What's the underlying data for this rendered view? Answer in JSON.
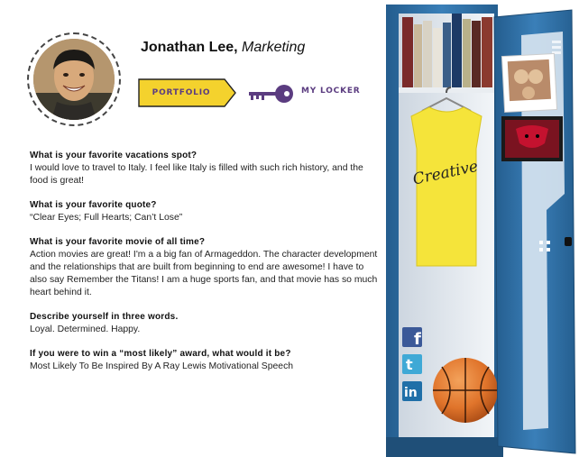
{
  "colors": {
    "locker_blue": "#2f6ea3",
    "portfolio_yellow": "#f4d22d",
    "label_purple": "#5b3c80",
    "shirt_yellow": "#f5e43a",
    "basketball": "#e0742b"
  },
  "profile": {
    "name": "Jonathan Lee,",
    "department": "Marketing",
    "avatar_icon": "profile-photo"
  },
  "nav": {
    "portfolio_label": "PORTFOLIO",
    "key_icon": "key-icon",
    "my_locker_label": "MY LOCKER"
  },
  "qa": [
    {
      "question": "What is your favorite vacations spot?",
      "answer": "I would love to travel to Italy. I feel like Italy is filled with such rich history, and the food is great!"
    },
    {
      "question": "What is your favorite quote?",
      "answer": "“Clear Eyes; Full Hearts; Can’t Lose”"
    },
    {
      "question": "What is your favorite movie of all time?",
      "answer": "Action movies are great! I'm a a big fan of Armageddon. The character development and the relationships that are built from beginning to end are awesome! I have to also say Remember the Titans! I am a huge sports fan, and that movie has so much heart behind it."
    },
    {
      "question": "Describe yourself in three words.",
      "answer": "Loyal. Determined. Happy."
    },
    {
      "question": "If you were to win a “most likely” award, what would it be?",
      "answer": "Most Likely To Be Inspired By A Ray Lewis Motivational Speech"
    }
  ],
  "locker": {
    "shirt_text": "Creative",
    "social": [
      "facebook-icon",
      "twitter-icon",
      "linkedin-icon"
    ]
  }
}
